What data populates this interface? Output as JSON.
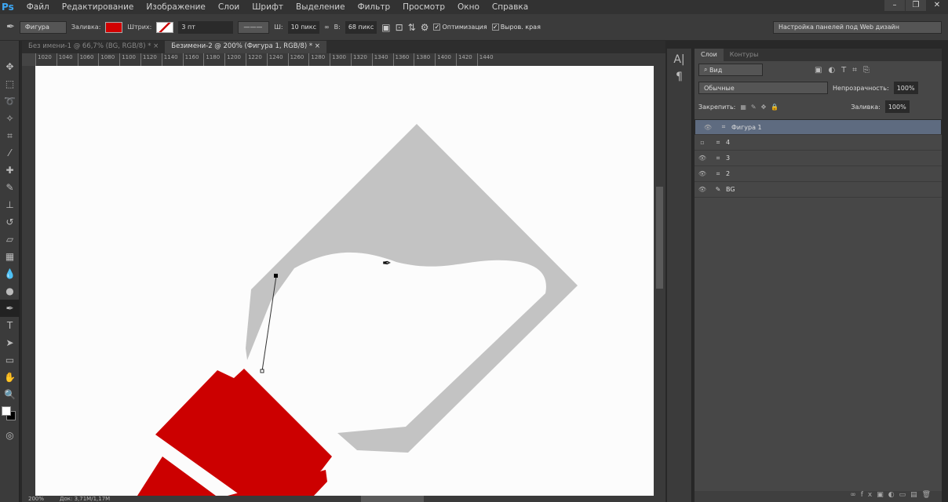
{
  "app": {
    "logo": "Ps"
  },
  "menu": [
    "Файл",
    "Редактирование",
    "Изображение",
    "Слои",
    "Шрифт",
    "Выделение",
    "Фильтр",
    "Просмотр",
    "Окно",
    "Справка"
  ],
  "window_controls": [
    "–",
    "❐",
    "✕"
  ],
  "options": {
    "mode": "Фигура",
    "fill_label": "Заливка:",
    "fill_color": "#d10000",
    "stroke_label": "Штрих:",
    "stroke_width": "3 пт",
    "w_label": "Ш:",
    "w_value": "10 пикс",
    "h_label": "В:",
    "h_value": "68 пикс",
    "optimize": "Оптимизация",
    "align_edges": "Выров. края",
    "workspace": "Настройка панелей под Web дизайн"
  },
  "tabs": [
    {
      "label": "Без имени-1 @ 66,7% (BG, RGB/8) *"
    },
    {
      "label": "Безимени-2 @ 200% (Фигура 1, RGB/8) *"
    }
  ],
  "ruler": [
    "1020",
    "1040",
    "1060",
    "1080",
    "1100",
    "1120",
    "1140",
    "1160",
    "1180",
    "1200",
    "1220",
    "1240",
    "1260",
    "1280",
    "1300",
    "1320",
    "1340",
    "1360",
    "1380",
    "1400",
    "1420",
    "1440"
  ],
  "status": {
    "zoom": "200%",
    "doc": "Док: 3,71M/1,17M"
  },
  "layers_panel": {
    "tab_layers": "Слои",
    "tab_paths": "Контуры",
    "filter": "Вид",
    "blend": "Обычные",
    "opacity_label": "Непрозрачность:",
    "opacity": "100%",
    "lock_label": "Закрепить:",
    "fill_label": "Заливка:",
    "fill": "100%",
    "layers": [
      {
        "name": "Фигура 1",
        "visible": true,
        "selected": true
      },
      {
        "name": "4",
        "visible": false
      },
      {
        "name": "3",
        "visible": true
      },
      {
        "name": "2",
        "visible": true
      },
      {
        "name": "BG",
        "visible": true
      }
    ]
  }
}
